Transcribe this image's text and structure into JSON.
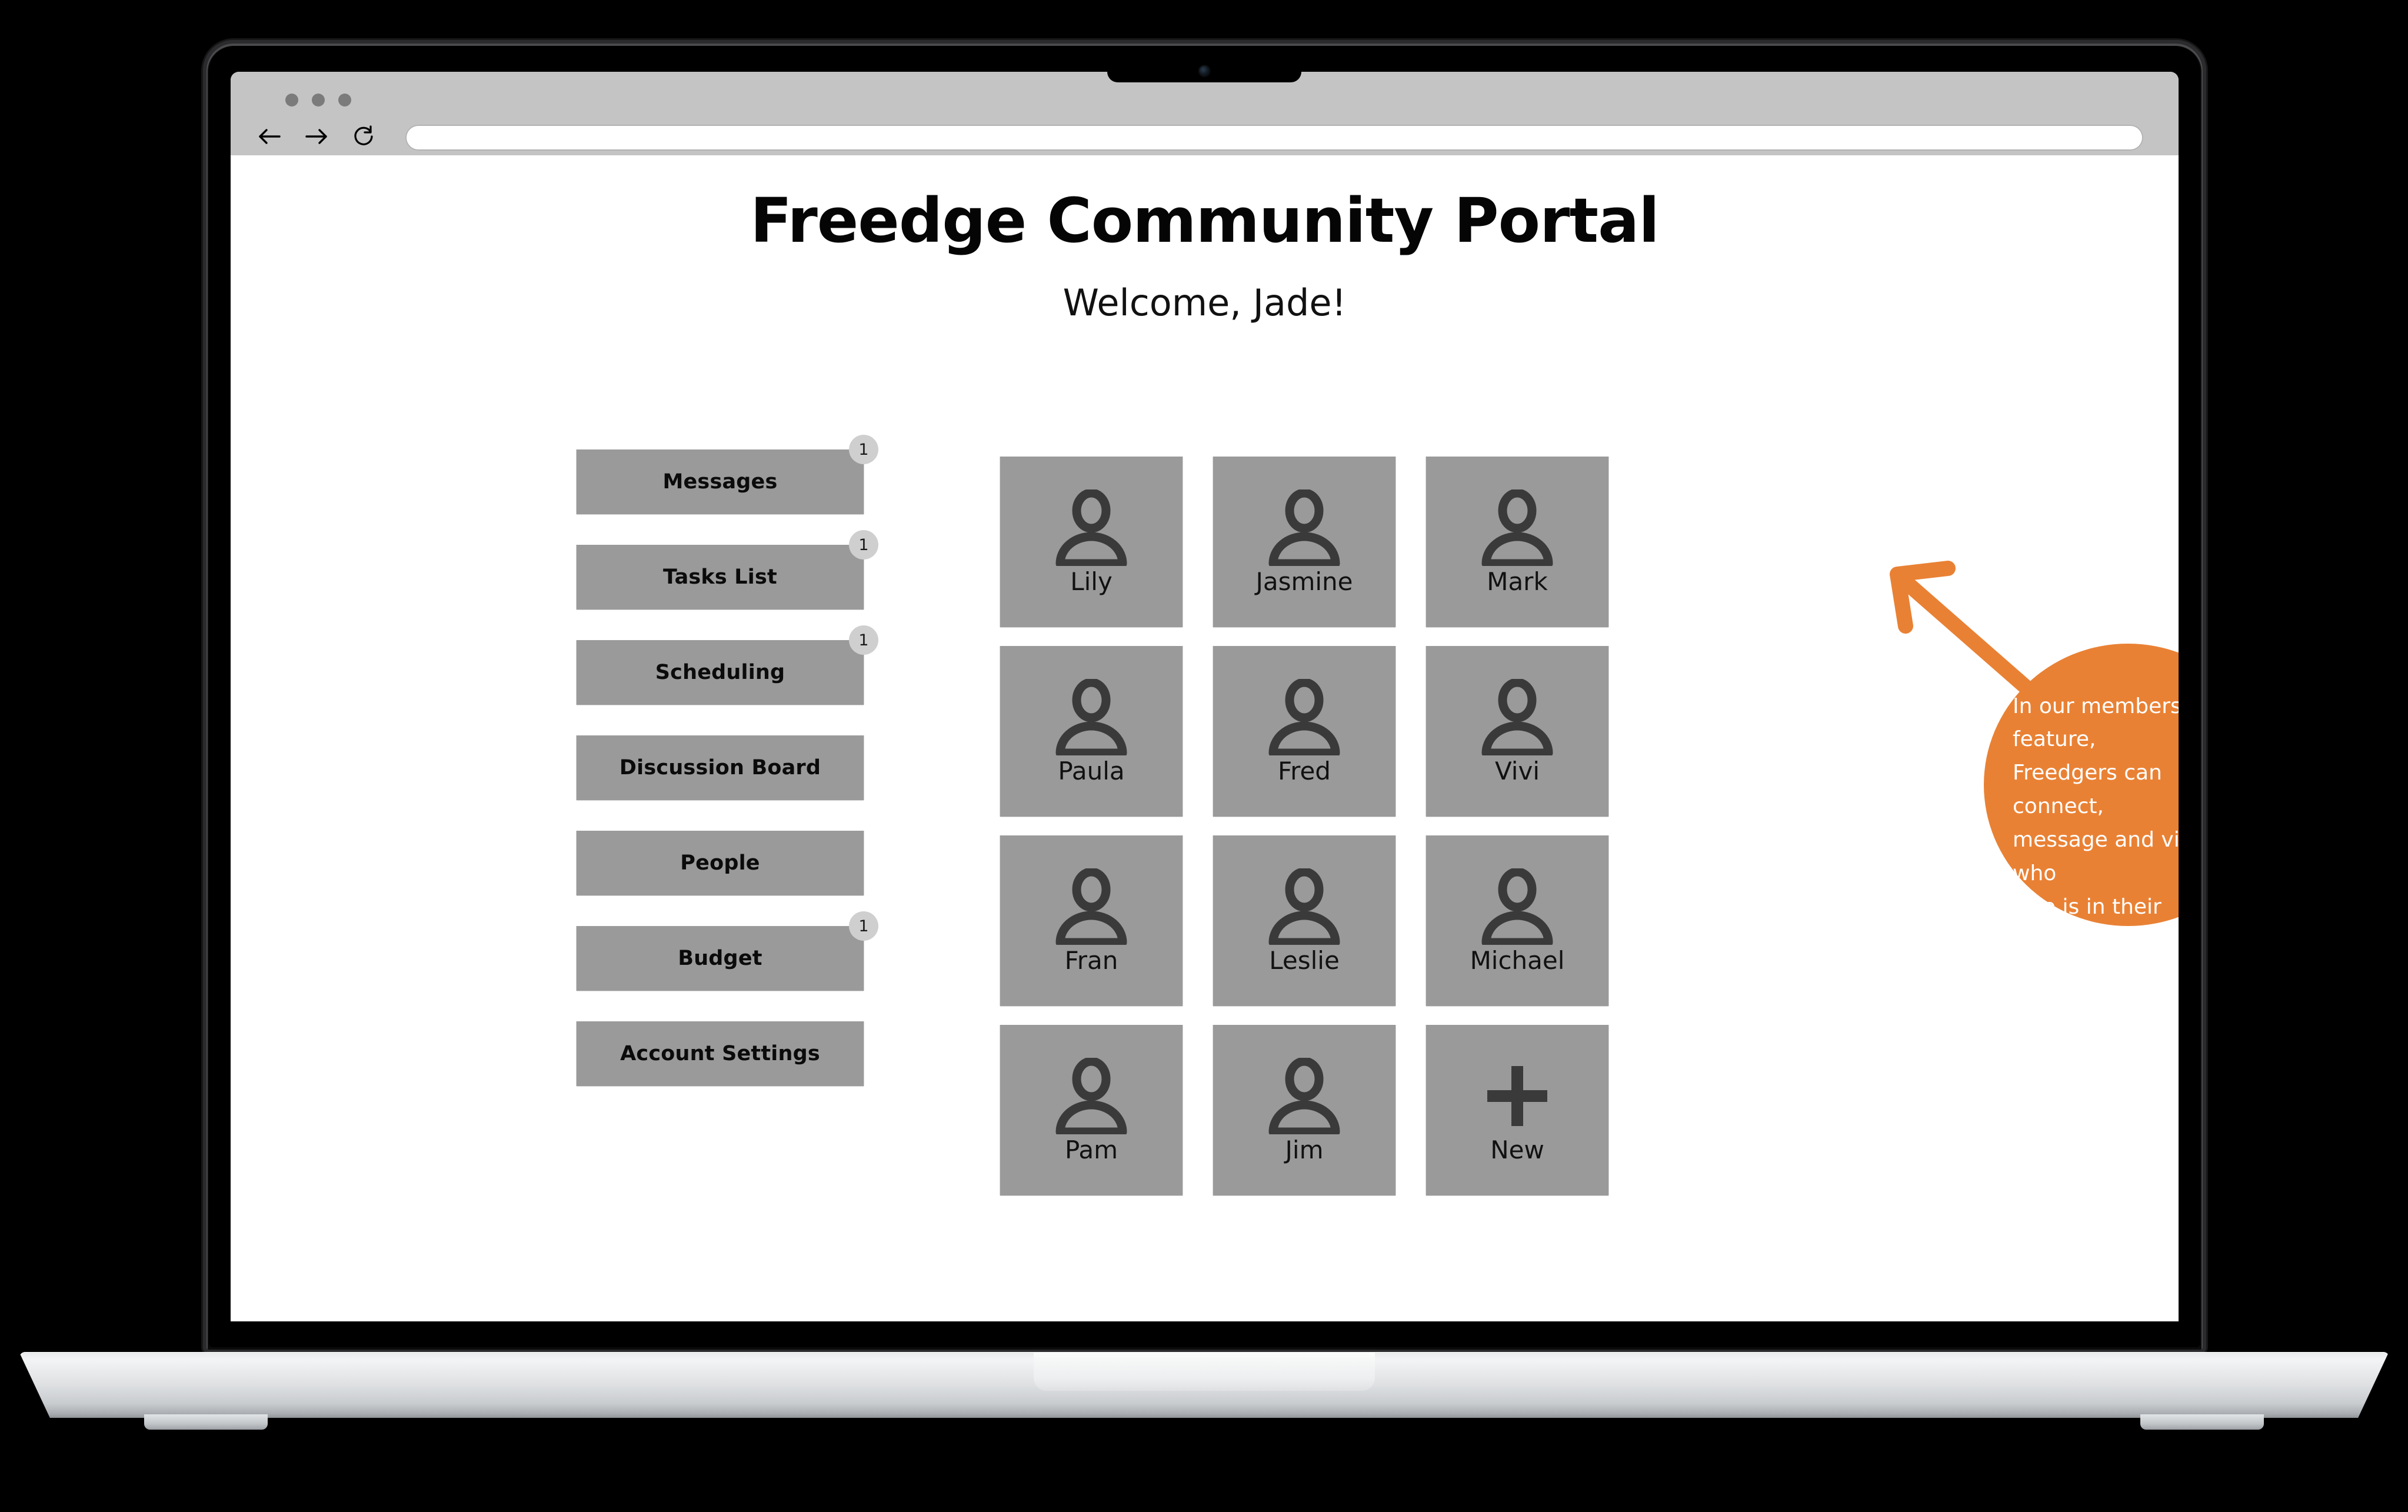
{
  "colors": {
    "accent_orange": "#e98134",
    "tile_gray": "#9a9a9a",
    "badge_gray": "#cfcfcf",
    "chrome_gray": "#c4c4c4",
    "icon_dark": "#3a3a3a",
    "page_background": "#ffffff"
  },
  "browser": {
    "window_dots": [
      "dot",
      "dot",
      "dot"
    ],
    "back_label": "Back",
    "forward_label": "Forward",
    "reload_label": "Reload",
    "url_value": "",
    "url_placeholder": ""
  },
  "page": {
    "title": "Freedge Community Portal",
    "welcome": "Welcome, Jade!"
  },
  "sidebar": {
    "items": [
      {
        "label": "Messages",
        "badge": "1"
      },
      {
        "label": "Tasks List",
        "badge": "1"
      },
      {
        "label": "Scheduling",
        "badge": "1"
      },
      {
        "label": "Discussion Board",
        "badge": ""
      },
      {
        "label": "People",
        "badge": ""
      },
      {
        "label": "Budget",
        "badge": "1"
      },
      {
        "label": "Account Settings",
        "badge": ""
      }
    ]
  },
  "members": {
    "grid": [
      {
        "name": "Lily",
        "icon": "person-icon"
      },
      {
        "name": "Jasmine",
        "icon": "person-icon"
      },
      {
        "name": "Mark",
        "icon": "person-icon"
      },
      {
        "name": "Paula",
        "icon": "person-icon"
      },
      {
        "name": "Fred",
        "icon": "person-icon"
      },
      {
        "name": "Vivi",
        "icon": "person-icon"
      },
      {
        "name": "Fran",
        "icon": "person-icon"
      },
      {
        "name": "Leslie",
        "icon": "person-icon"
      },
      {
        "name": "Michael",
        "icon": "person-icon"
      },
      {
        "name": "Pam",
        "icon": "person-icon"
      },
      {
        "name": "Jim",
        "icon": "person-icon"
      },
      {
        "name": "New",
        "icon": "plus-icon"
      }
    ]
  },
  "annotation": {
    "text": "In our members feature,\nFreedgers can connect,\nmessage and view who\nelse is in their community"
  }
}
